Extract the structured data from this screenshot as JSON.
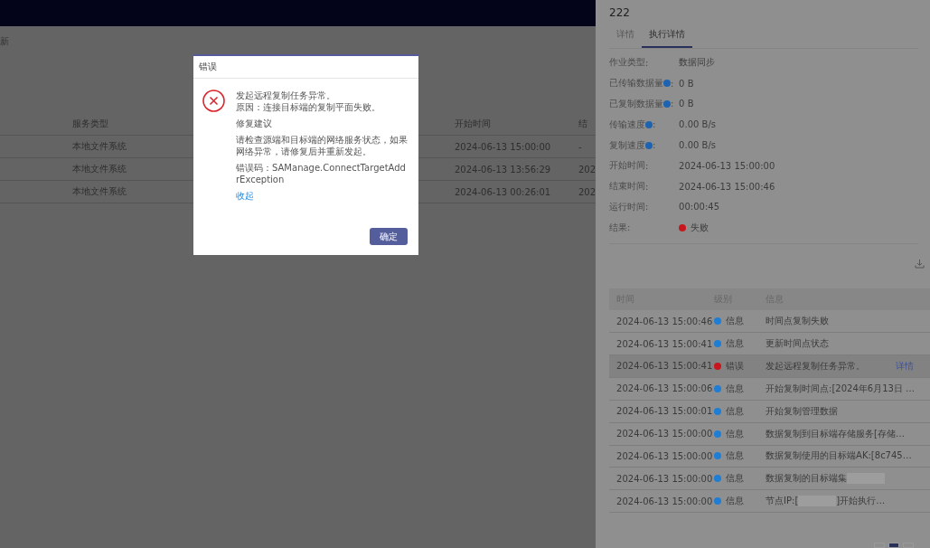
{
  "background_page": {
    "toolbar_text": "新",
    "table": {
      "columns": [
        "服务类型",
        "开始时间",
        "结"
      ],
      "rows": [
        {
          "cells": [
            "本地文件系统",
            "2024-06-13 15:00:00",
            "-"
          ]
        },
        {
          "cells": [
            "本地文件系统",
            "2024-06-13 13:56:29",
            "202"
          ]
        },
        {
          "cells": [
            "本地文件系统",
            "2024-06-13 00:26:01",
            "202"
          ]
        }
      ]
    }
  },
  "dialog": {
    "title": "错误",
    "message_lines": [
      "发起远程复制任务异常。",
      "原因：连接目标端的复制平面失败。"
    ],
    "suggestion_heading": "修复建议",
    "suggestion": "请检查源端和目标端的网络服务状态，如果网络异常，请修复后并重新发起。",
    "error_code": "错误码：SAManage.ConnectTargetAddrException",
    "collapse_link": "收起",
    "ok_button": "确定"
  },
  "panel": {
    "title": "222",
    "tabs": [
      {
        "label": "详情",
        "selected": false
      },
      {
        "label": "执行详情",
        "selected": true
      }
    ],
    "fields": [
      {
        "label": "作业类型",
        "help": false,
        "separator": ":",
        "value": "数据同步"
      },
      {
        "label": "已传输数据量",
        "help": true,
        "separator": ":",
        "value": "0 B"
      },
      {
        "label": "已复制数据量",
        "help": true,
        "separator": ":",
        "value": "0 B"
      },
      {
        "label": "传输速度",
        "help": true,
        "separator": ":",
        "value": "0.00 B/s"
      },
      {
        "label": "复制速度",
        "help": true,
        "separator": ":",
        "value": "0.00 B/s"
      },
      {
        "label": "开始时间",
        "help": false,
        "separator": ":",
        "value": "2024-06-13 15:00:00"
      },
      {
        "label": "结束时间",
        "help": false,
        "separator": ":",
        "value": "2024-06-13 15:00:46"
      },
      {
        "label": "运行时间",
        "help": false,
        "separator": ":",
        "value": "00:00:45"
      },
      {
        "label": "结果",
        "help": false,
        "separator": ":",
        "value": "失败",
        "color": "#c8171c"
      }
    ],
    "log": {
      "columns": [
        "时间",
        "级别",
        "信息"
      ],
      "rows": [
        {
          "time": "2024-06-13 15:00:46",
          "level": "信息",
          "color": "#1f7ed3",
          "selected": false,
          "message": [
            {
              "kind": "text",
              "text": "时间点复制失败"
            }
          ]
        },
        {
          "time": "2024-06-13 15:00:41",
          "level": "信息",
          "color": "#1f7ed3",
          "selected": false,
          "message": [
            {
              "kind": "text",
              "text": "更新时间点状态"
            }
          ]
        },
        {
          "time": "2024-06-13 15:00:41",
          "level": "错误",
          "color": "#c8171c",
          "selected": true,
          "message": [
            {
              "kind": "text",
              "text": "发起远程复制任务异常。"
            }
          ],
          "action": "详情"
        },
        {
          "time": "2024-06-13 15:00:06",
          "level": "信息",
          "color": "#1f7ed3",
          "selected": false,
          "message": [
            {
              "kind": "text",
              "text": "开始复制时间点:[2024年6月13日 …"
            }
          ]
        },
        {
          "time": "2024-06-13 15:00:01",
          "level": "信息",
          "color": "#1f7ed3",
          "selected": false,
          "message": [
            {
              "kind": "text",
              "text": "开始复制管理数据"
            }
          ]
        },
        {
          "time": "2024-06-13 15:00:00",
          "level": "信息",
          "color": "#1f7ed3",
          "selected": false,
          "message": [
            {
              "kind": "text",
              "text": "数据复制到目标端存储服务[存储…"
            }
          ]
        },
        {
          "time": "2024-06-13 15:00:00",
          "level": "信息",
          "color": "#1f7ed3",
          "selected": false,
          "message": [
            {
              "kind": "text",
              "text": "数据复制使用的目标端AK:[8c745…"
            }
          ]
        },
        {
          "time": "2024-06-13 15:00:00",
          "level": "信息",
          "color": "#1f7ed3",
          "selected": false,
          "message": [
            {
              "kind": "text",
              "text": "数据复制的目标端集"
            },
            {
              "kind": "redaction"
            }
          ]
        },
        {
          "time": "2024-06-13 15:00:00",
          "level": "信息",
          "color": "#1f7ed3",
          "selected": false,
          "message": [
            {
              "kind": "text",
              "text": "节点IP:["
            },
            {
              "kind": "redaction"
            },
            {
              "kind": "text",
              "text": "]开始执行…"
            }
          ]
        }
      ]
    },
    "pagination": [
      {
        "selected": false
      },
      {
        "selected": true
      },
      {
        "selected": false
      }
    ]
  }
}
